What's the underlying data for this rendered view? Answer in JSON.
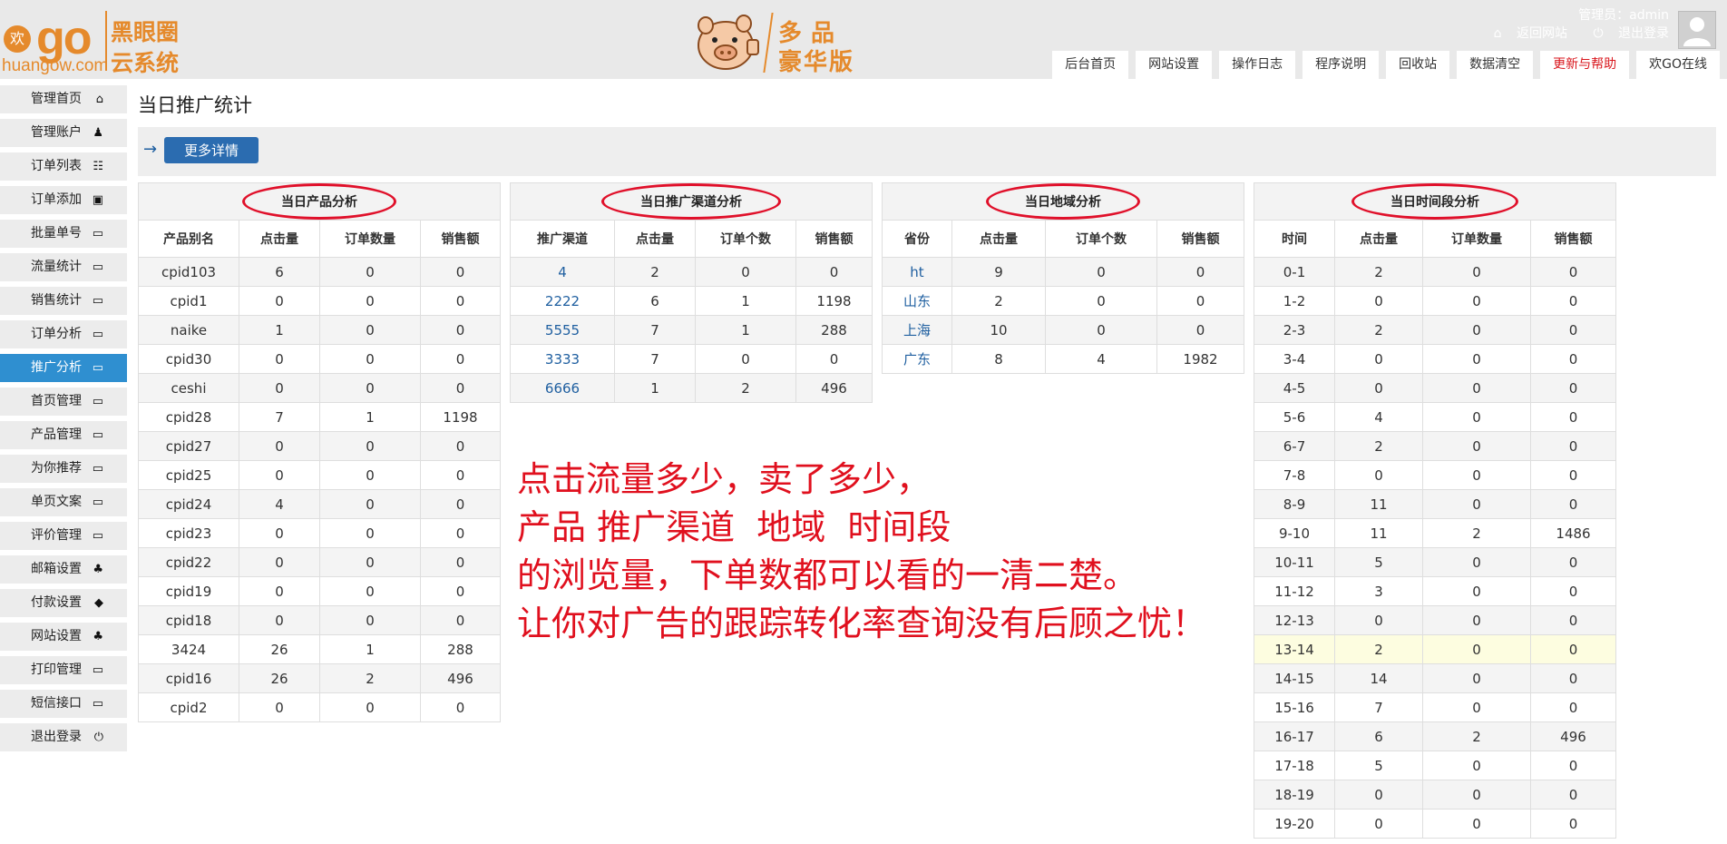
{
  "header": {
    "logo_circle": "欢",
    "logo_go": "go",
    "logo_domain": "huangow.com",
    "brand_line1": "黑眼圈",
    "brand_line2": "云系统",
    "edition_line1": "多品",
    "edition_line2": "豪华版",
    "admin_label": "管理员：admin",
    "back_site": "返回网站",
    "logout": "退出登录",
    "nav_tabs": [
      "后台首页",
      "网站设置",
      "操作日志",
      "程序说明",
      "回收站",
      "数据清空",
      "更新与帮助",
      "欢GO在线"
    ]
  },
  "sidebar": {
    "items": [
      {
        "label": "管理首页",
        "icon": "⌂"
      },
      {
        "label": "管理账户",
        "icon": "♟"
      },
      {
        "label": "订单列表",
        "icon": "☷"
      },
      {
        "label": "订单添加",
        "icon": "▣"
      },
      {
        "label": "批量单号",
        "icon": "▭"
      },
      {
        "label": "流量统计",
        "icon": "▭"
      },
      {
        "label": "销售统计",
        "icon": "▭"
      },
      {
        "label": "订单分析",
        "icon": "▭"
      },
      {
        "label": "推广分析",
        "icon": "▭"
      },
      {
        "label": "首页管理",
        "icon": "▭"
      },
      {
        "label": "产品管理",
        "icon": "▭"
      },
      {
        "label": "为你推荐",
        "icon": "▭"
      },
      {
        "label": "单页文案",
        "icon": "▭"
      },
      {
        "label": "评价管理",
        "icon": "▭"
      },
      {
        "label": "邮箱设置",
        "icon": "♣"
      },
      {
        "label": "付款设置",
        "icon": "◆"
      },
      {
        "label": "网站设置",
        "icon": "♣"
      },
      {
        "label": "打印管理",
        "icon": "▭"
      },
      {
        "label": "短信接口",
        "icon": "▭"
      },
      {
        "label": "退出登录",
        "icon": "⏻"
      }
    ]
  },
  "main": {
    "title": "当日推广统计",
    "arrow": "→",
    "more_button": "更多详情"
  },
  "tables": {
    "product": {
      "caption": "当日产品分析",
      "headers": [
        "产品别名",
        "点击量",
        "订单数量",
        "销售额"
      ],
      "rows": [
        [
          "cpid103",
          "6",
          "0",
          "0"
        ],
        [
          "cpid1",
          "0",
          "0",
          "0"
        ],
        [
          "naike",
          "1",
          "0",
          "0"
        ],
        [
          "cpid30",
          "0",
          "0",
          "0"
        ],
        [
          "ceshi",
          "0",
          "0",
          "0"
        ],
        [
          "cpid28",
          "7",
          "1",
          "1198"
        ],
        [
          "cpid27",
          "0",
          "0",
          "0"
        ],
        [
          "cpid25",
          "0",
          "0",
          "0"
        ],
        [
          "cpid24",
          "4",
          "0",
          "0"
        ],
        [
          "cpid23",
          "0",
          "0",
          "0"
        ],
        [
          "cpid22",
          "0",
          "0",
          "0"
        ],
        [
          "cpid19",
          "0",
          "0",
          "0"
        ],
        [
          "cpid18",
          "0",
          "0",
          "0"
        ],
        [
          "3424",
          "26",
          "1",
          "288"
        ],
        [
          "cpid16",
          "26",
          "2",
          "496"
        ],
        [
          "cpid2",
          "0",
          "0",
          "0"
        ]
      ]
    },
    "channel": {
      "caption": "当日推广渠道分析",
      "headers": [
        "推广渠道",
        "点击量",
        "订单个数",
        "销售额"
      ],
      "rows": [
        [
          "4",
          "2",
          "0",
          "0"
        ],
        [
          "2222",
          "6",
          "1",
          "1198"
        ],
        [
          "5555",
          "7",
          "1",
          "288"
        ],
        [
          "3333",
          "7",
          "0",
          "0"
        ],
        [
          "6666",
          "1",
          "2",
          "496"
        ]
      ]
    },
    "region": {
      "caption": "当日地域分析",
      "headers": [
        "省份",
        "点击量",
        "订单个数",
        "销售额"
      ],
      "rows": [
        [
          "ht",
          "9",
          "0",
          "0"
        ],
        [
          "山东",
          "2",
          "0",
          "0"
        ],
        [
          "上海",
          "10",
          "0",
          "0"
        ],
        [
          "广东",
          "8",
          "4",
          "1982"
        ]
      ]
    },
    "time": {
      "caption": "当日时间段分析",
      "headers": [
        "时间",
        "点击量",
        "订单数量",
        "销售额"
      ],
      "rows": [
        [
          "0-1",
          "2",
          "0",
          "0"
        ],
        [
          "1-2",
          "0",
          "0",
          "0"
        ],
        [
          "2-3",
          "2",
          "0",
          "0"
        ],
        [
          "3-4",
          "0",
          "0",
          "0"
        ],
        [
          "4-5",
          "0",
          "0",
          "0"
        ],
        [
          "5-6",
          "4",
          "0",
          "0"
        ],
        [
          "6-7",
          "2",
          "0",
          "0"
        ],
        [
          "7-8",
          "0",
          "0",
          "0"
        ],
        [
          "8-9",
          "11",
          "0",
          "0"
        ],
        [
          "9-10",
          "11",
          "2",
          "1486"
        ],
        [
          "10-11",
          "5",
          "0",
          "0"
        ],
        [
          "11-12",
          "3",
          "0",
          "0"
        ],
        [
          "12-13",
          "0",
          "0",
          "0"
        ],
        [
          "13-14",
          "2",
          "0",
          "0"
        ],
        [
          "14-15",
          "14",
          "0",
          "0"
        ],
        [
          "15-16",
          "7",
          "0",
          "0"
        ],
        [
          "16-17",
          "6",
          "2",
          "496"
        ],
        [
          "17-18",
          "5",
          "0",
          "0"
        ],
        [
          "18-19",
          "0",
          "0",
          "0"
        ],
        [
          "19-20",
          "0",
          "0",
          "0"
        ]
      ]
    }
  },
  "annotation": {
    "lines": [
      "点击流量多少，卖了多少，",
      "产品 推广渠道  地域  时间段",
      "的浏览量，下单数都可以看的一清二楚。",
      "让你对广告的跟踪转化率查询没有后顾之忧！"
    ]
  },
  "colors": {
    "accent": "#e58a2c",
    "active": "#2f8fd0",
    "annotation": "#e0101e",
    "oval": "#e0102a"
  }
}
